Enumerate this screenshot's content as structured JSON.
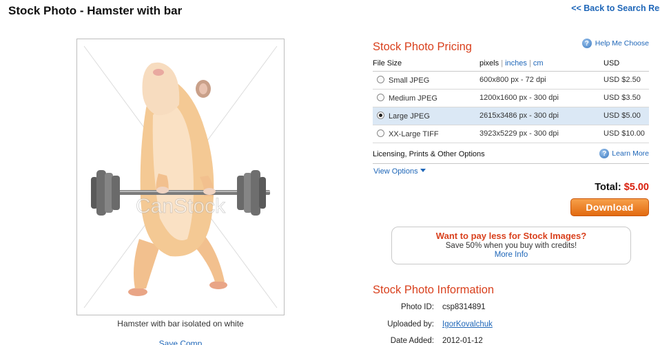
{
  "page": {
    "title": "Stock Photo - Hamster with bar",
    "back_link": "<< Back to Search Res"
  },
  "photo": {
    "watermark": "CanStock",
    "caption": "Hamster with bar isolated on white",
    "save_comp": "Save Comp"
  },
  "pricing": {
    "title": "Stock Photo Pricing",
    "help_label": "Help Me Choose",
    "headers": {
      "file_size": "File Size",
      "pixels": "pixels",
      "inches": "inches",
      "cm": "cm",
      "usd": "USD"
    },
    "rows": [
      {
        "size": "Small JPEG",
        "pixels": "600x800 px - 72 dpi",
        "price": "USD $2.50",
        "selected": false
      },
      {
        "size": "Medium JPEG",
        "pixels": "1200x1600 px - 300 dpi",
        "price": "USD $3.50",
        "selected": false
      },
      {
        "size": "Large JPEG",
        "pixels": "2615x3486 px - 300 dpi",
        "price": "USD $5.00",
        "selected": true
      },
      {
        "size": "XX-Large TIFF",
        "pixels": "3923x5229 px - 300 dpi",
        "price": "USD $10.00",
        "selected": false
      }
    ],
    "licensing_label": "Licensing, Prints & Other Options",
    "learn_more": "Learn More",
    "view_options": "View Options",
    "total_label": "Total:",
    "total_value": "$5.00",
    "download_label": "Download"
  },
  "promo": {
    "title": "Want to pay less for Stock Images?",
    "subtitle": "Save 50% when you buy with credits!",
    "link": "More Info"
  },
  "info": {
    "title": "Stock Photo Information",
    "photo_id_label": "Photo ID:",
    "photo_id": "csp8314891",
    "uploaded_by_label": "Uploaded by:",
    "uploaded_by": "IgorKovalchuk",
    "date_added_label": "Date Added:",
    "date_added": "2012-01-12"
  },
  "colors": {
    "accent_orange": "#d9411e",
    "link_blue": "#1e66b8",
    "download_orange": "#e26a10",
    "selected_row": "#dbe8f5"
  }
}
